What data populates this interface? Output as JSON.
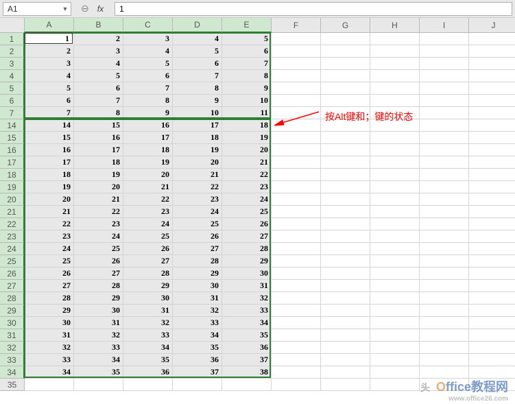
{
  "formula_bar": {
    "name_box": "A1",
    "fx_label": "fx",
    "formula_value": "1"
  },
  "annotation": {
    "text": "按Alt键和；键的状态"
  },
  "watermark": {
    "text1": "O",
    "text2": "ffice",
    "text3": "教程网",
    "subtext": "www.office26.com"
  },
  "columns": [
    "A",
    "B",
    "C",
    "D",
    "E",
    "F",
    "G",
    "H",
    "I",
    "J"
  ],
  "selected_cols": [
    "A",
    "B",
    "C",
    "D",
    "E"
  ],
  "visible_rows": [
    1,
    2,
    3,
    4,
    5,
    6,
    7,
    14,
    15,
    16,
    17,
    18,
    19,
    20,
    21,
    22,
    23,
    24,
    25,
    26,
    27,
    28,
    29,
    30,
    31,
    32,
    33,
    34,
    35
  ],
  "selected_rows": [
    1,
    2,
    3,
    4,
    5,
    6,
    7,
    14,
    15,
    16,
    17,
    18,
    19,
    20,
    21,
    22,
    23,
    24,
    25,
    26,
    27,
    28,
    29,
    30,
    31,
    32,
    33,
    34
  ],
  "data_block1_rows": [
    1,
    2,
    3,
    4,
    5,
    6,
    7
  ],
  "data_block2_rows": [
    14,
    15,
    16,
    17,
    18,
    19,
    20,
    21,
    22,
    23,
    24,
    25,
    26,
    27,
    28,
    29,
    30,
    31,
    32,
    33,
    34
  ],
  "cells": {
    "1": {
      "A": "1",
      "B": "2",
      "C": "3",
      "D": "4",
      "E": "5"
    },
    "2": {
      "A": "2",
      "B": "3",
      "C": "4",
      "D": "5",
      "E": "6"
    },
    "3": {
      "A": "3",
      "B": "4",
      "C": "5",
      "D": "6",
      "E": "7"
    },
    "4": {
      "A": "4",
      "B": "5",
      "C": "6",
      "D": "7",
      "E": "8"
    },
    "5": {
      "A": "5",
      "B": "6",
      "C": "7",
      "D": "8",
      "E": "9"
    },
    "6": {
      "A": "6",
      "B": "7",
      "C": "8",
      "D": "9",
      "E": "10"
    },
    "7": {
      "A": "7",
      "B": "8",
      "C": "9",
      "D": "10",
      "E": "11"
    },
    "14": {
      "A": "14",
      "B": "15",
      "C": "16",
      "D": "17",
      "E": "18"
    },
    "15": {
      "A": "15",
      "B": "16",
      "C": "17",
      "D": "18",
      "E": "19"
    },
    "16": {
      "A": "16",
      "B": "17",
      "C": "18",
      "D": "19",
      "E": "20"
    },
    "17": {
      "A": "17",
      "B": "18",
      "C": "19",
      "D": "20",
      "E": "21"
    },
    "18": {
      "A": "18",
      "B": "19",
      "C": "20",
      "D": "21",
      "E": "22"
    },
    "19": {
      "A": "19",
      "B": "20",
      "C": "21",
      "D": "22",
      "E": "23"
    },
    "20": {
      "A": "20",
      "B": "21",
      "C": "22",
      "D": "23",
      "E": "24"
    },
    "21": {
      "A": "21",
      "B": "22",
      "C": "23",
      "D": "24",
      "E": "25"
    },
    "22": {
      "A": "22",
      "B": "23",
      "C": "24",
      "D": "25",
      "E": "26"
    },
    "23": {
      "A": "23",
      "B": "24",
      "C": "25",
      "D": "26",
      "E": "27"
    },
    "24": {
      "A": "24",
      "B": "25",
      "C": "26",
      "D": "27",
      "E": "28"
    },
    "25": {
      "A": "25",
      "B": "26",
      "C": "27",
      "D": "28",
      "E": "29"
    },
    "26": {
      "A": "26",
      "B": "27",
      "C": "28",
      "D": "29",
      "E": "30"
    },
    "27": {
      "A": "27",
      "B": "28",
      "C": "29",
      "D": "30",
      "E": "31"
    },
    "28": {
      "A": "28",
      "B": "29",
      "C": "30",
      "D": "31",
      "E": "32"
    },
    "29": {
      "A": "29",
      "B": "30",
      "C": "31",
      "D": "32",
      "E": "33"
    },
    "30": {
      "A": "30",
      "B": "31",
      "C": "32",
      "D": "33",
      "E": "34"
    },
    "31": {
      "A": "31",
      "B": "32",
      "C": "33",
      "D": "34",
      "E": "35"
    },
    "32": {
      "A": "32",
      "B": "33",
      "C": "34",
      "D": "35",
      "E": "36"
    },
    "33": {
      "A": "33",
      "B": "34",
      "C": "35",
      "D": "36",
      "E": "37"
    },
    "34": {
      "A": "34",
      "B": "35",
      "C": "36",
      "D": "37",
      "E": "38"
    }
  }
}
